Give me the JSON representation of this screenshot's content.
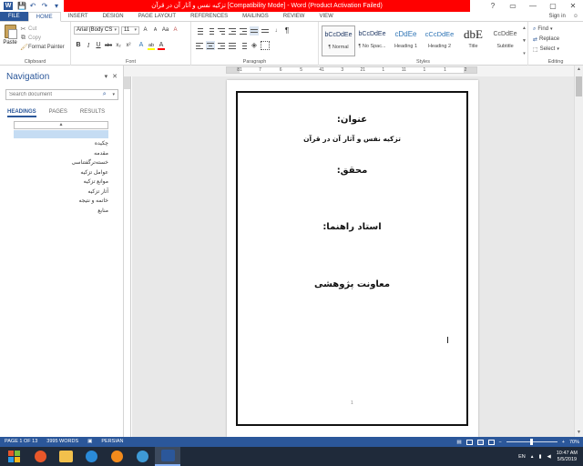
{
  "window": {
    "title": "تزکیه نفس و آثار آن در قرآن [Compatibility Mode] - Word (Product Activation Failed)",
    "quick_access": {
      "app_icon": "W",
      "save": "💾",
      "undo": "↶",
      "redo": "↷",
      "more": "▾"
    },
    "controls": {
      "help": "?",
      "ribbon_options": "▭",
      "minimize": "—",
      "maximize": "▢",
      "close": "✕"
    }
  },
  "tabs": [
    "FILE",
    "HOME",
    "INSERT",
    "DESIGN",
    "PAGE LAYOUT",
    "REFERENCES",
    "MAILINGS",
    "REVIEW",
    "VIEW"
  ],
  "signin": "Sign in",
  "ribbon": {
    "clipboard": {
      "label": "Clipboard",
      "paste": "Paste",
      "cut": "Cut",
      "copy": "Copy",
      "format_painter": "Format Painter"
    },
    "font": {
      "label": "Font",
      "name": "Arial (Body CS",
      "size": "11",
      "grow": "A",
      "shrink": "A",
      "change_case": "Aa",
      "clear": "A",
      "bold": "B",
      "italic": "I",
      "underline": "U",
      "strike": "abc",
      "subscript": "x₂",
      "superscript": "x²",
      "effects": "A",
      "highlight": "ab",
      "font_color": "A",
      "highlight_color": "#ffff00",
      "font_color_value": "#ff0000"
    },
    "paragraph": {
      "label": "Paragraph",
      "show_marks": "¶"
    },
    "styles": {
      "label": "Styles",
      "items": [
        {
          "preview": "bCcDdEe",
          "name": "¶ Normal"
        },
        {
          "preview": "bCcDdEe",
          "name": "¶ No Spac..."
        },
        {
          "preview": "cDdEe",
          "name": "Heading 1"
        },
        {
          "preview": "cCcDdEe",
          "name": "Heading 2"
        },
        {
          "preview": "dbE",
          "name": "Title"
        },
        {
          "preview": "CcDdEe",
          "name": "Subtitle"
        }
      ]
    },
    "editing": {
      "label": "Editing",
      "find": "Find",
      "replace": "Replace",
      "select": "Select"
    }
  },
  "ruler": {
    "numbers": [
      "81",
      "7",
      "6",
      "5",
      "41",
      "3",
      "21",
      "1",
      "11",
      "1",
      "1",
      "2"
    ]
  },
  "navigation": {
    "title": "Navigation",
    "search_placeholder": "Search document",
    "tabs": [
      "HEADINGS",
      "PAGES",
      "RESULTS"
    ],
    "collapse": "▴",
    "headings": [
      "چکیده",
      "مقدمه",
      "خسته‌ترگفتنا‌سی",
      "عوامل تزکیه",
      "موانع تزکیه",
      "آثار تزکیه",
      "خاتمه و نتیجه",
      "منابع"
    ]
  },
  "document": {
    "title_label": "عنوان:",
    "subject": "تزکیه نفس و آثار آن در قرآن",
    "researcher_label": "محقق:",
    "advisor_label": "استاد راهنما:",
    "deputy": "معاونت پژوهشی",
    "page_dot": "1"
  },
  "status": {
    "page": "PAGE 1 OF 13",
    "words": "3995 WORDS",
    "language": "PERSIAN",
    "zoom": "70%",
    "zoom_level": 0.7
  },
  "taskbar": {
    "tray_lang": "EN",
    "time": "10:47 AM",
    "date": "5/5/2019"
  }
}
